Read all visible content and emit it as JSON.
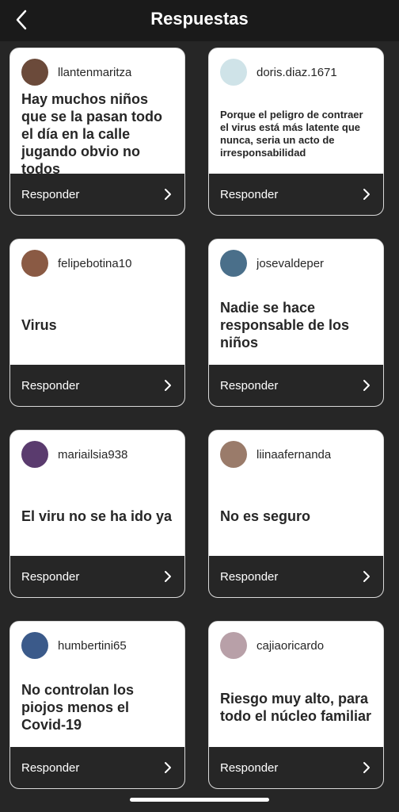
{
  "header": {
    "title": "Respuestas"
  },
  "colors": {
    "background": "#262626",
    "header": "#1a1a1a",
    "card": "#ffffff",
    "text": "#262626"
  },
  "icons": {
    "back": "chevron-left-icon",
    "footer": "chevron-right-icon"
  },
  "cards": [
    {
      "username": "llantenmaritza",
      "text": "Hay muchos niños que se la pasan todo el día en la calle jugando obvio no todos",
      "footer": "Responder",
      "avatar_color": "#6b4a3a"
    },
    {
      "username": "doris.diaz.1671",
      "text": "Porque el peligro de contraer el virus está más latente que nunca, seria un acto de irresponsabilidad",
      "footer": "Responder",
      "avatar_color": "#cfe3e8"
    },
    {
      "username": "felipebotina10",
      "text": "Virus",
      "footer": "Responder",
      "avatar_color": "#8a5a44"
    },
    {
      "username": "josevaldeper",
      "text": "Nadie se hace responsable de los niños",
      "footer": "Responder",
      "avatar_color": "#4a6f8a"
    },
    {
      "username": "mariailsia938",
      "text": "El viru no se ha ido ya",
      "footer": "Responder",
      "avatar_color": "#5a3b6e"
    },
    {
      "username": "liinaafernanda",
      "text": "No es seguro",
      "footer": "Responder",
      "avatar_color": "#9a7b6a"
    },
    {
      "username": "humbertini65",
      "text": "No controlan los piojos menos el Covid-19",
      "footer": "Responder",
      "avatar_color": "#3b5a8a"
    },
    {
      "username": "cajiaoricardo",
      "text": "Riesgo muy alto, para todo el núcleo familiar",
      "footer": "Responder",
      "avatar_color": "#b8a0a8"
    }
  ]
}
